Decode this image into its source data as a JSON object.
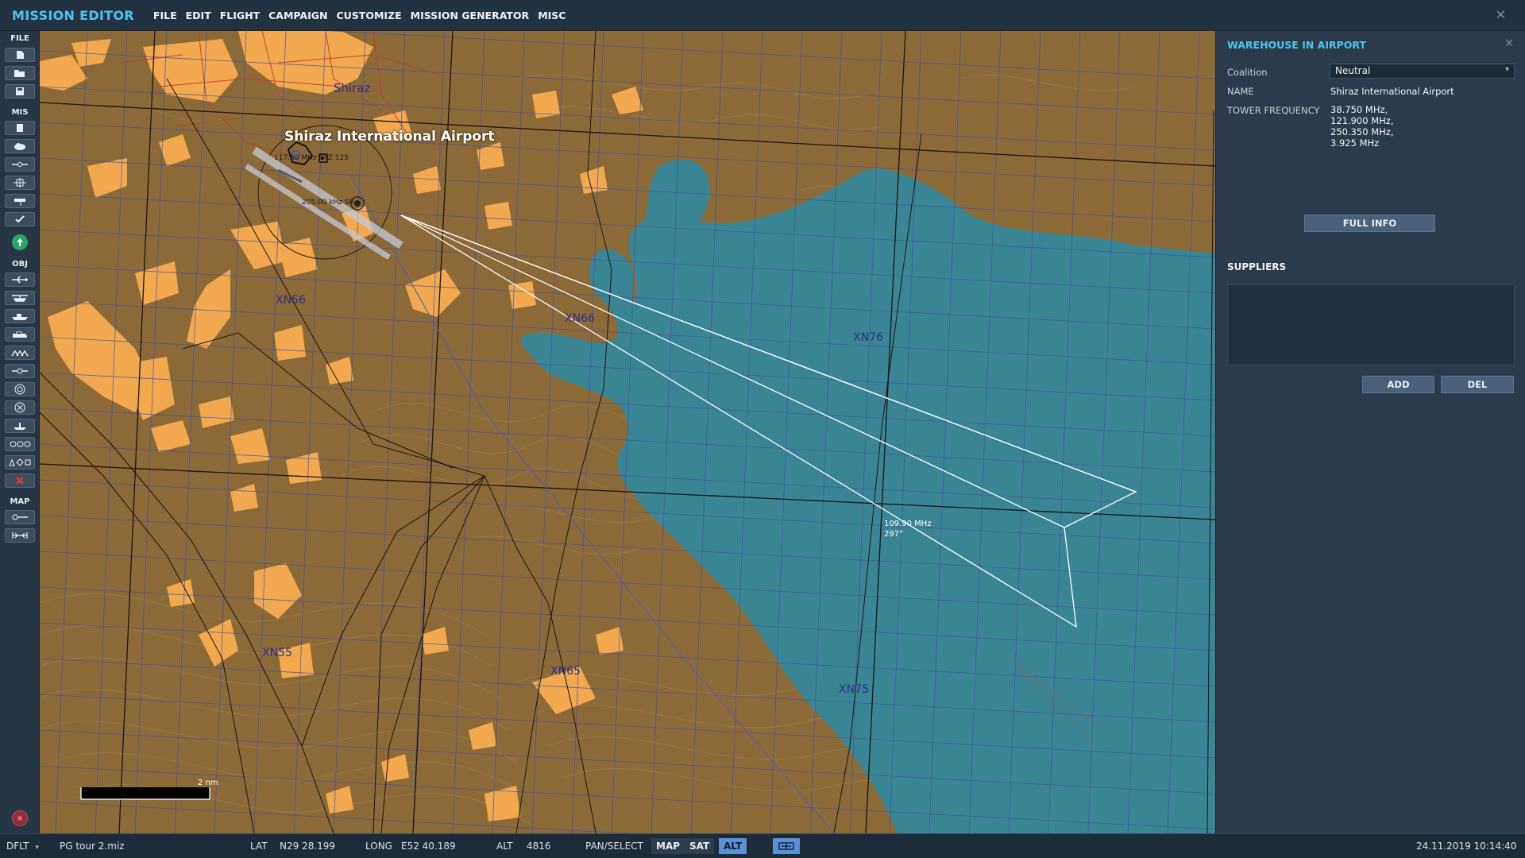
{
  "app": {
    "title": "MISSION EDITOR",
    "menu": [
      "FILE",
      "EDIT",
      "FLIGHT",
      "CAMPAIGN",
      "CUSTOMIZE",
      "MISSION GENERATOR",
      "MISC"
    ],
    "close_glyph": "✕"
  },
  "toolbar": {
    "sections": {
      "file": "FILE",
      "mis": "MIS",
      "obj": "OBJ",
      "map": "MAP"
    },
    "file_buttons": [
      "new-file-icon",
      "open-folder-icon",
      "save-icon"
    ],
    "mis_buttons": [
      "briefing-icon",
      "weather-icon",
      "trigger-icon",
      "failures-icon",
      "flag-icon",
      "checkmark-icon"
    ],
    "obj_buttons": [
      "airplane-icon",
      "helicopter-icon",
      "ship-icon",
      "vehicle-icon",
      "armor-group-icon",
      "static-icon",
      "target-icon",
      "nav-point-icon",
      "carrier-icon",
      "formation-icon",
      "shapes-icon",
      "delete-icon"
    ],
    "map_buttons": [
      "map-options-icon",
      "ruler-icon"
    ]
  },
  "map": {
    "grid_labels": [
      "XN56",
      "XN66",
      "XN76",
      "XN55",
      "XN65",
      "XN75"
    ],
    "city_label": "Shiraz",
    "airport_name": "Shiraz International Airport",
    "nav_text_1": "117.80 MHz SYZ 125",
    "nav_text_2": "205.00 kHz SR",
    "ils_freq": "109.90 MHz",
    "ils_heading": "297°",
    "scale_label": "2 nm",
    "colors": {
      "land": "#8c6a37",
      "urban": "#f2a84f",
      "water": "#3a8593",
      "grid": "#3d4fa8"
    }
  },
  "panel": {
    "title": "WAREHOUSE IN AIRPORT",
    "coalition_label": "Coalition",
    "coalition_value": "Neutral",
    "name_label": "NAME",
    "name_value": "Shiraz International Airport",
    "tower_label": "TOWER FREQUENCY",
    "tower_values": [
      "38.750 MHz,",
      "121.900 MHz,",
      "250.350 MHz,",
      "3.925 MHz"
    ],
    "full_info_button": "FULL INFO",
    "suppliers_heading": "SUPPLIERS",
    "add_button": "ADD",
    "del_button": "DEL"
  },
  "statusbar": {
    "profile": "DFLT",
    "mission_file": "PG tour 2.miz",
    "lat_label": "LAT",
    "lat_value": "N29 28.199",
    "long_label": "LONG",
    "long_value": "E52 40.189",
    "alt_label": "ALT",
    "alt_value": "4816",
    "mode": "PAN/SELECT",
    "map_btn": "MAP",
    "sat_btn": "SAT",
    "alt_btn": "ALT",
    "datetime": "24.11.2019 10:14:40"
  }
}
